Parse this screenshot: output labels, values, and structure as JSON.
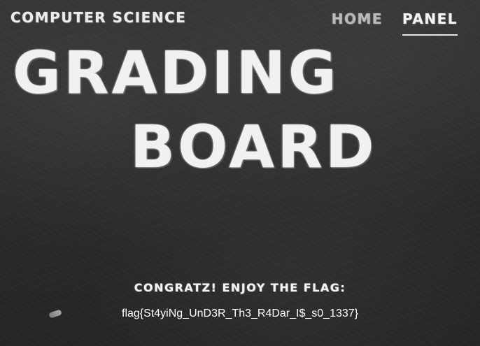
{
  "header": {
    "site_name": "Computer Science"
  },
  "nav": {
    "items": [
      {
        "label": "Home",
        "active": false
      },
      {
        "label": "Panel",
        "active": true
      }
    ]
  },
  "hero": {
    "title_line1": "Grading",
    "title_line2": "Board"
  },
  "content": {
    "message": "Congratz! Enjoy the flag:",
    "flag": "flag{St4yiNg_UnD3R_Th3_R4Dar_I$_s0_1337}"
  },
  "colors": {
    "background": "#2c2c2c",
    "chalk": "#f2f2f2",
    "nav_inactive": "#b9b9b9"
  }
}
